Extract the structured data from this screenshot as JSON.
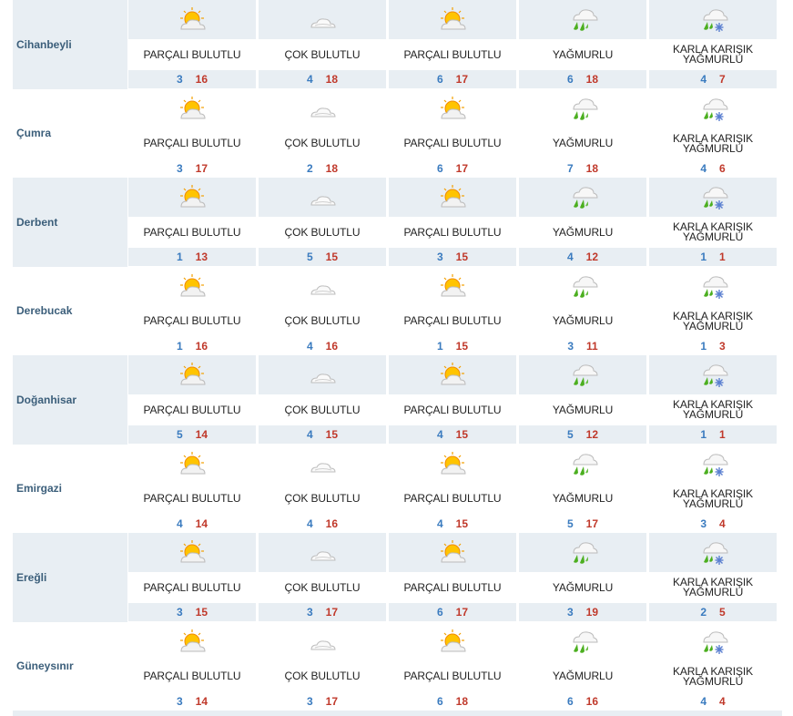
{
  "columns": [
    {
      "icon": "partly-cloudy-icon",
      "desc": "PARÇALI BULUTLU"
    },
    {
      "icon": "cloudy-icon",
      "desc": "ÇOK BULUTLU"
    },
    {
      "icon": "partly-cloudy-icon",
      "desc": "PARÇALI BULUTLU"
    },
    {
      "icon": "rain-icon",
      "desc": "YAĞMURLU"
    },
    {
      "icon": "sleet-icon",
      "desc": "KARLA KARIŞIK YAĞMURLU"
    }
  ],
  "rows": [
    {
      "city": "Cihanbeyli",
      "days": [
        {
          "desc": "PARÇALI BULUTLU",
          "min": "3",
          "max": "16"
        },
        {
          "desc": "ÇOK BULUTLU",
          "min": "4",
          "max": "18"
        },
        {
          "desc": "PARÇALI BULUTLU",
          "min": "6",
          "max": "17"
        },
        {
          "desc": "YAĞMURLU",
          "min": "6",
          "max": "18"
        },
        {
          "desc": "KARLA KARIŞIK YAĞMURLU",
          "min": "4",
          "max": "7"
        }
      ]
    },
    {
      "city": "Çumra",
      "days": [
        {
          "desc": "PARÇALI BULUTLU",
          "min": "3",
          "max": "17"
        },
        {
          "desc": "ÇOK BULUTLU",
          "min": "2",
          "max": "18"
        },
        {
          "desc": "PARÇALI BULUTLU",
          "min": "6",
          "max": "17"
        },
        {
          "desc": "YAĞMURLU",
          "min": "7",
          "max": "18"
        },
        {
          "desc": "KARLA KARIŞIK YAĞMURLU",
          "min": "4",
          "max": "6"
        }
      ]
    },
    {
      "city": "Derbent",
      "days": [
        {
          "desc": "PARÇALI BULUTLU",
          "min": "1",
          "max": "13"
        },
        {
          "desc": "ÇOK BULUTLU",
          "min": "5",
          "max": "15"
        },
        {
          "desc": "PARÇALI BULUTLU",
          "min": "3",
          "max": "15"
        },
        {
          "desc": "YAĞMURLU",
          "min": "4",
          "max": "12"
        },
        {
          "desc": "KARLA KARIŞIK YAĞMURLU",
          "min": "1",
          "max": "1"
        }
      ]
    },
    {
      "city": "Derebucak",
      "days": [
        {
          "desc": "PARÇALI BULUTLU",
          "min": "1",
          "max": "16"
        },
        {
          "desc": "ÇOK BULUTLU",
          "min": "4",
          "max": "16"
        },
        {
          "desc": "PARÇALI BULUTLU",
          "min": "1",
          "max": "15"
        },
        {
          "desc": "YAĞMURLU",
          "min": "3",
          "max": "11"
        },
        {
          "desc": "KARLA KARIŞIK YAĞMURLU",
          "min": "1",
          "max": "3"
        }
      ]
    },
    {
      "city": "Doğanhisar",
      "days": [
        {
          "desc": "PARÇALI BULUTLU",
          "min": "5",
          "max": "14"
        },
        {
          "desc": "ÇOK BULUTLU",
          "min": "4",
          "max": "15"
        },
        {
          "desc": "PARÇALI BULUTLU",
          "min": "4",
          "max": "15"
        },
        {
          "desc": "YAĞMURLU",
          "min": "5",
          "max": "12"
        },
        {
          "desc": "KARLA KARIŞIK YAĞMURLU",
          "min": "1",
          "max": "1"
        }
      ]
    },
    {
      "city": "Emirgazi",
      "days": [
        {
          "desc": "PARÇALI BULUTLU",
          "min": "4",
          "max": "14"
        },
        {
          "desc": "ÇOK BULUTLU",
          "min": "4",
          "max": "16"
        },
        {
          "desc": "PARÇALI BULUTLU",
          "min": "4",
          "max": "15"
        },
        {
          "desc": "YAĞMURLU",
          "min": "5",
          "max": "17"
        },
        {
          "desc": "KARLA KARIŞIK YAĞMURLU",
          "min": "3",
          "max": "4"
        }
      ]
    },
    {
      "city": "Ereğli",
      "days": [
        {
          "desc": "PARÇALI BULUTLU",
          "min": "3",
          "max": "15"
        },
        {
          "desc": "ÇOK BULUTLU",
          "min": "3",
          "max": "17"
        },
        {
          "desc": "PARÇALI BULUTLU",
          "min": "6",
          "max": "17"
        },
        {
          "desc": "YAĞMURLU",
          "min": "3",
          "max": "19"
        },
        {
          "desc": "KARLA KARIŞIK YAĞMURLU",
          "min": "2",
          "max": "5"
        }
      ]
    },
    {
      "city": "Güneysınır",
      "days": [
        {
          "desc": "PARÇALI BULUTLU",
          "min": "3",
          "max": "14"
        },
        {
          "desc": "ÇOK BULUTLU",
          "min": "3",
          "max": "17"
        },
        {
          "desc": "PARÇALI BULUTLU",
          "min": "6",
          "max": "18"
        },
        {
          "desc": "YAĞMURLU",
          "min": "6",
          "max": "16"
        },
        {
          "desc": "KARLA KARIŞIK YAĞMURLU",
          "min": "4",
          "max": "4"
        }
      ]
    }
  ],
  "colors": {
    "band": "#e8eef3",
    "city": "#3b5e7a",
    "min": "#3a7bbf",
    "max": "#c0392b"
  }
}
